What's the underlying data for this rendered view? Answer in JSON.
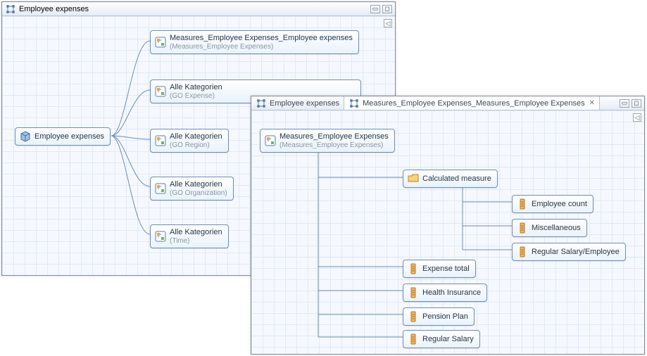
{
  "panel1": {
    "title": "Employee expenses",
    "root": {
      "label": "Employee expenses"
    },
    "children": [
      {
        "label": "Measures_Employee Expenses_Employee expenses",
        "sub": "(Measures_Employee Expenses)"
      },
      {
        "label": "Alle Kategorien",
        "sub": "(GO Expense)"
      },
      {
        "label": "Alle Kategorien",
        "sub": "(GO Region)"
      },
      {
        "label": "Alle Kategorien",
        "sub": "(GO Organization)"
      },
      {
        "label": "Alle Kategorien",
        "sub": "(Time)"
      }
    ]
  },
  "panel2": {
    "tabs": [
      {
        "label": "Employee expenses",
        "active": false
      },
      {
        "label": "Measures_Employee Expenses_Measures_Employee Expenses",
        "active": true
      }
    ],
    "root": {
      "label": "Measures_Employee Expenses",
      "sub": "(Measures_Employee Expenses)"
    },
    "calc": {
      "label": "Calculated measure"
    },
    "calc_children": [
      {
        "label": "Employee count"
      },
      {
        "label": "Miscellaneous"
      },
      {
        "label": "Regular Salary/Employee"
      }
    ],
    "measures": [
      {
        "label": "Expense total"
      },
      {
        "label": "Health Insurance"
      },
      {
        "label": "Pension Plan"
      },
      {
        "label": "Regular Salary"
      }
    ]
  }
}
